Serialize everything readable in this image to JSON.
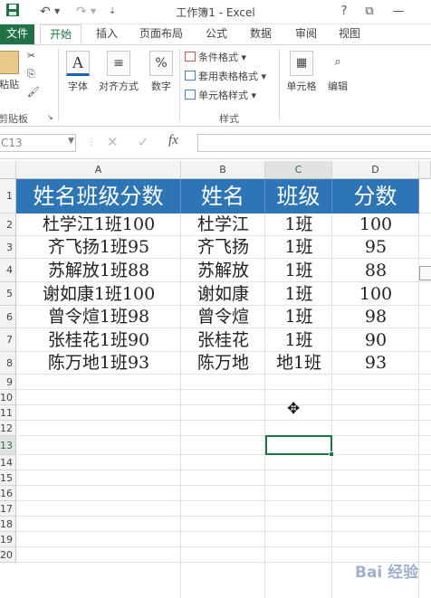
{
  "titlebar": {
    "title": "工作簿1 - Excel",
    "help": "?",
    "restore": "⧉",
    "minimize": "—"
  },
  "tabs": [
    "文件",
    "开始",
    "插入",
    "页面布局",
    "公式",
    "数据",
    "审阅",
    "视图"
  ],
  "ribbon": {
    "paste": "粘贴",
    "clipboard": "剪贴板",
    "font": "字体",
    "align": "对齐方式",
    "number": "数字",
    "cond_format": "条件格式",
    "table_format": "套用表格格式",
    "cell_style": "单元格样式",
    "styles": "样式",
    "cells": "单元格",
    "edit": "编辑"
  },
  "formula_bar": {
    "name_box": "C13",
    "fx": "fx",
    "cancel": "✕",
    "enter": "✓",
    "value": ""
  },
  "grid": {
    "columns": [
      "A",
      "B",
      "C",
      "D"
    ],
    "rows": [
      "1",
      "2",
      "3",
      "4",
      "5",
      "6",
      "7",
      "8",
      "9",
      "10",
      "11",
      "12",
      "13",
      "14",
      "15",
      "16",
      "17",
      "18",
      "19",
      "20"
    ],
    "header": [
      "姓名班级分数",
      "姓名",
      "班级",
      "分数"
    ],
    "data": [
      [
        "杜学江1班100",
        "杜学江",
        "1班",
        "100"
      ],
      [
        "齐飞扬1班95",
        "齐飞扬",
        "1班",
        "95"
      ],
      [
        "苏解放1班88",
        "苏解放",
        "1班",
        "88"
      ],
      [
        "谢如康1班100",
        "谢如康",
        "1班",
        "100"
      ],
      [
        "曾令煊1班98",
        "曾令煊",
        "1班",
        "98"
      ],
      [
        "张桂花1班90",
        "张桂花",
        "1班",
        "90"
      ],
      [
        "陈万地1班93",
        "陈万地",
        "地1班",
        "93"
      ]
    ],
    "selected_cell": "C13"
  },
  "watermark": "Bai 经验"
}
